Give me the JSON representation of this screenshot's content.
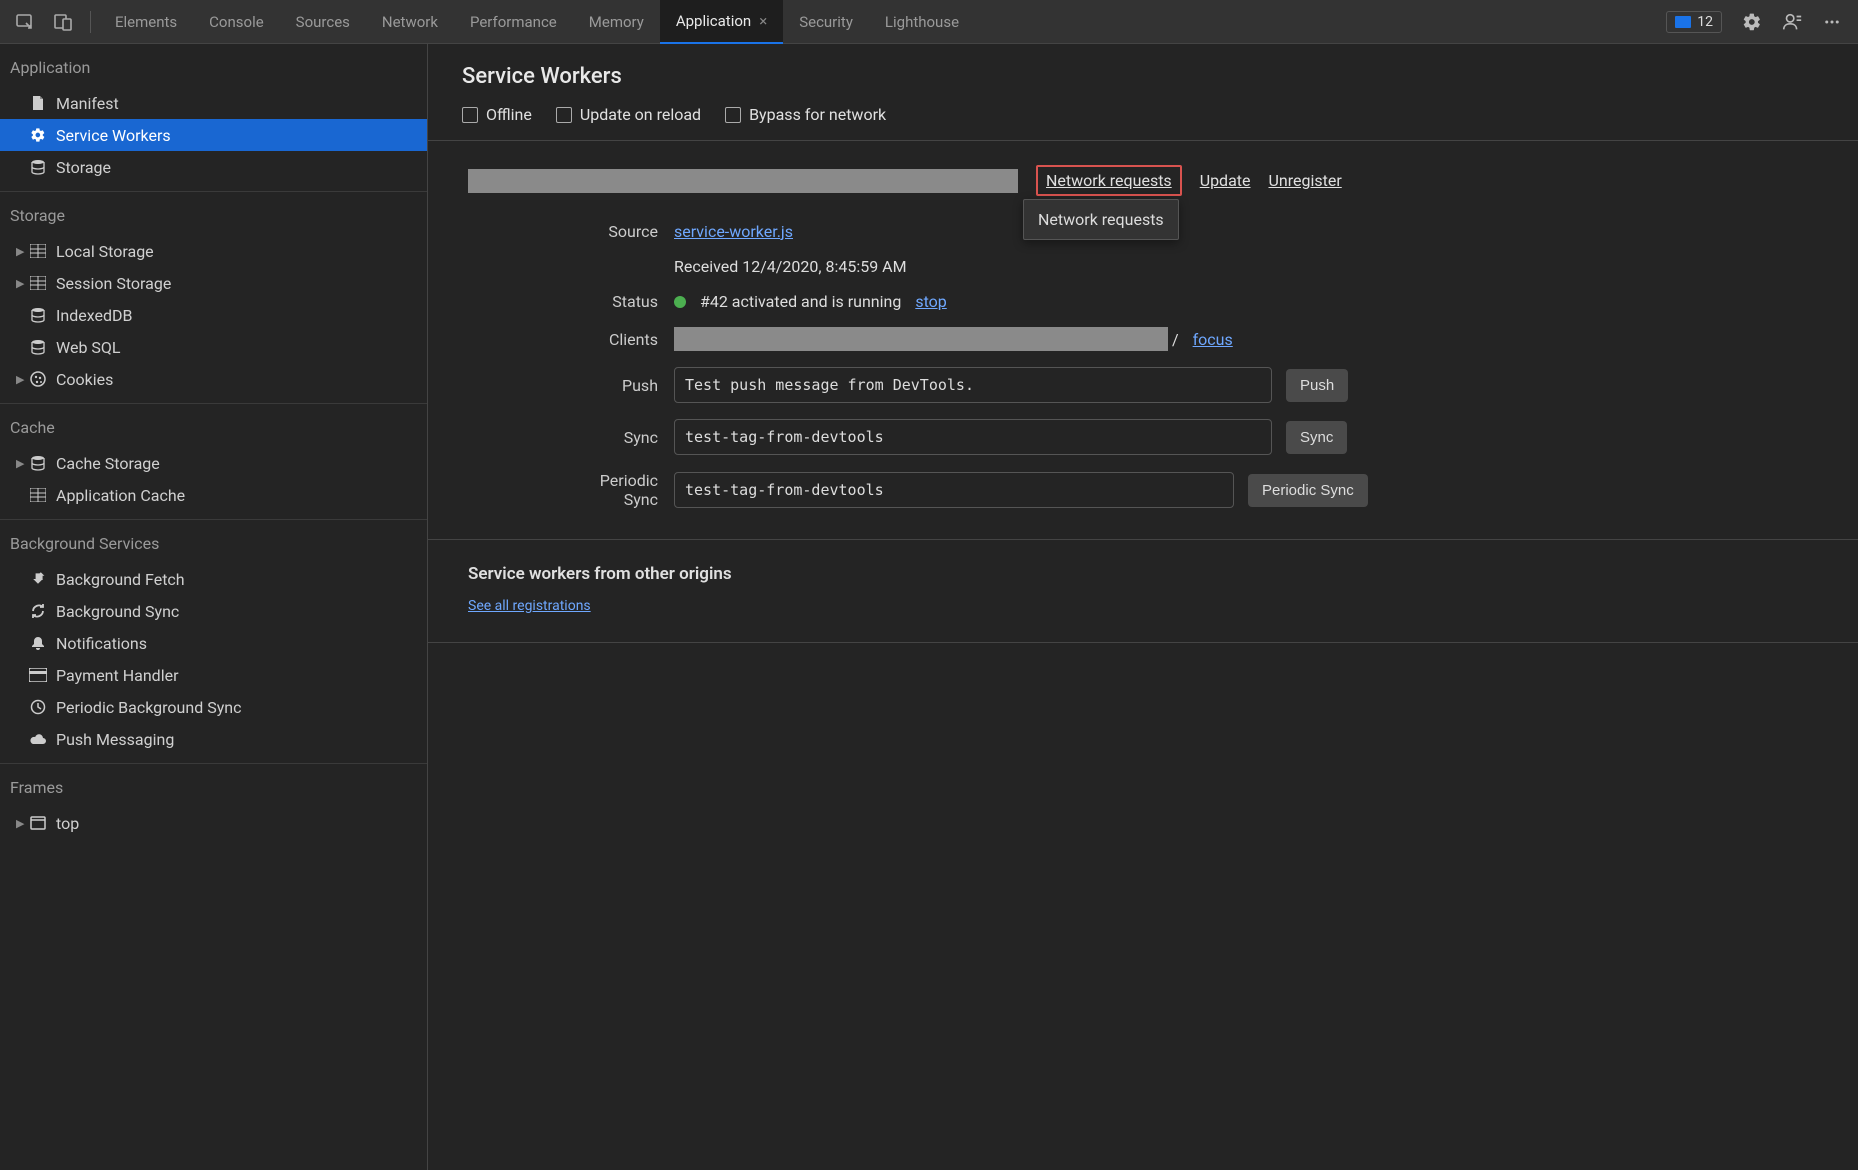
{
  "tabs": {
    "items": [
      {
        "label": "Elements"
      },
      {
        "label": "Console"
      },
      {
        "label": "Sources"
      },
      {
        "label": "Network"
      },
      {
        "label": "Performance"
      },
      {
        "label": "Memory"
      },
      {
        "label": "Application",
        "active": true
      },
      {
        "label": "Security"
      },
      {
        "label": "Lighthouse"
      }
    ]
  },
  "errors_count": "12",
  "sidebar": {
    "sections": {
      "application": {
        "title": "Application",
        "items": [
          "Manifest",
          "Service Workers",
          "Storage"
        ]
      },
      "storage": {
        "title": "Storage",
        "items": [
          "Local Storage",
          "Session Storage",
          "IndexedDB",
          "Web SQL",
          "Cookies"
        ]
      },
      "cache": {
        "title": "Cache",
        "items": [
          "Cache Storage",
          "Application Cache"
        ]
      },
      "background": {
        "title": "Background Services",
        "items": [
          "Background Fetch",
          "Background Sync",
          "Notifications",
          "Payment Handler",
          "Periodic Background Sync",
          "Push Messaging"
        ]
      },
      "frames": {
        "title": "Frames",
        "items": [
          "top"
        ]
      }
    }
  },
  "header": {
    "title": "Service Workers",
    "checks": {
      "offline": "Offline",
      "update": "Update on reload",
      "bypass": "Bypass for network"
    }
  },
  "links": {
    "network_requests": "Network requests",
    "update": "Update",
    "unregister": "Unregister"
  },
  "tooltip": "Network requests",
  "detail": {
    "labels": {
      "source": "Source",
      "status": "Status",
      "clients": "Clients",
      "push": "Push",
      "sync": "Sync",
      "periodic_sync": "Periodic Sync"
    },
    "source_link": "service-worker.js",
    "received": "Received 12/4/2020, 8:45:59 AM",
    "status_text": "#42 activated and is running",
    "status_stop": "stop",
    "clients_suffix": "/",
    "clients_focus": "focus",
    "push_value": "Test push message from DevTools.",
    "sync_value": "test-tag-from-devtools",
    "periodic_value": "test-tag-from-devtools",
    "buttons": {
      "push": "Push",
      "sync": "Sync",
      "periodic": "Periodic Sync"
    }
  },
  "other_origins": {
    "title": "Service workers from other origins",
    "link": "See all registrations"
  }
}
